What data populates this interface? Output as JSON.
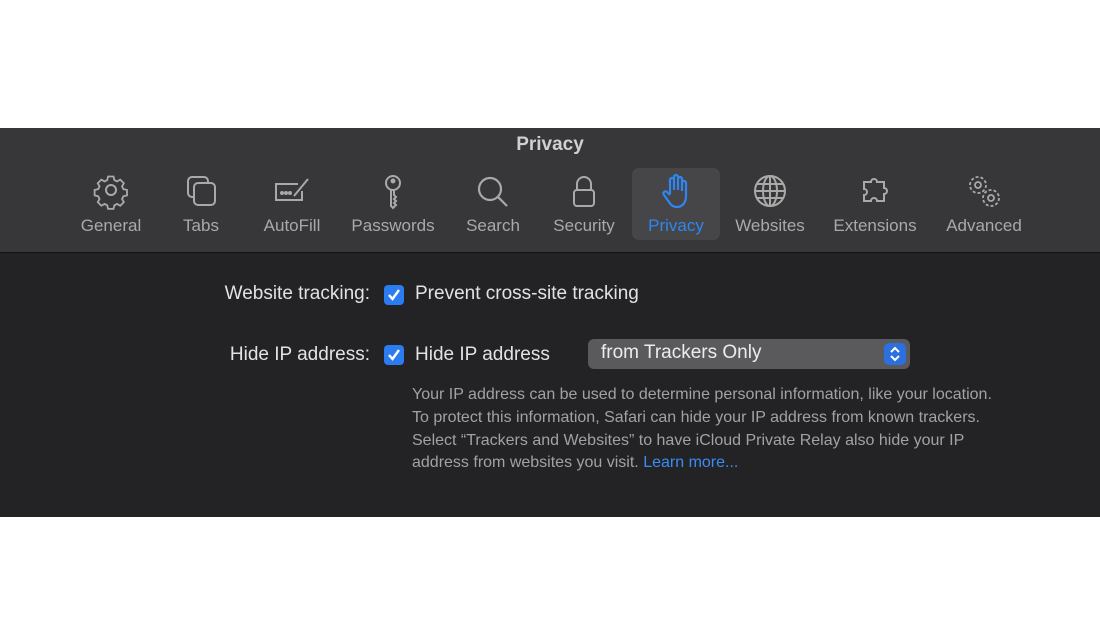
{
  "window": {
    "title": "Privacy"
  },
  "tabs": [
    {
      "label": "General",
      "icon": "gear-icon"
    },
    {
      "label": "Tabs",
      "icon": "tabs-icon"
    },
    {
      "label": "AutoFill",
      "icon": "autofill-icon"
    },
    {
      "label": "Passwords",
      "icon": "key-icon"
    },
    {
      "label": "Search",
      "icon": "magnifier-icon"
    },
    {
      "label": "Security",
      "icon": "lock-icon"
    },
    {
      "label": "Privacy",
      "icon": "hand-icon",
      "selected": true
    },
    {
      "label": "Websites",
      "icon": "globe-icon"
    },
    {
      "label": "Extensions",
      "icon": "puzzle-icon"
    },
    {
      "label": "Advanced",
      "icon": "gears-icon"
    }
  ],
  "accent": "#2b7cf0",
  "settings": {
    "tracking": {
      "label": "Website tracking:",
      "checkbox_label": "Prevent cross-site tracking",
      "checked": true
    },
    "ip": {
      "label": "Hide IP address:",
      "checkbox_label": "Hide IP address",
      "checked": true,
      "select_value": "from Trackers Only",
      "description": "Your IP address can be used to determine personal information, like your location. To protect this information, Safari can hide your IP address from known trackers. Select “Trackers and Websites” to have iCloud Private Relay also hide your IP address from websites you visit.",
      "learn_more": "Learn more..."
    }
  }
}
